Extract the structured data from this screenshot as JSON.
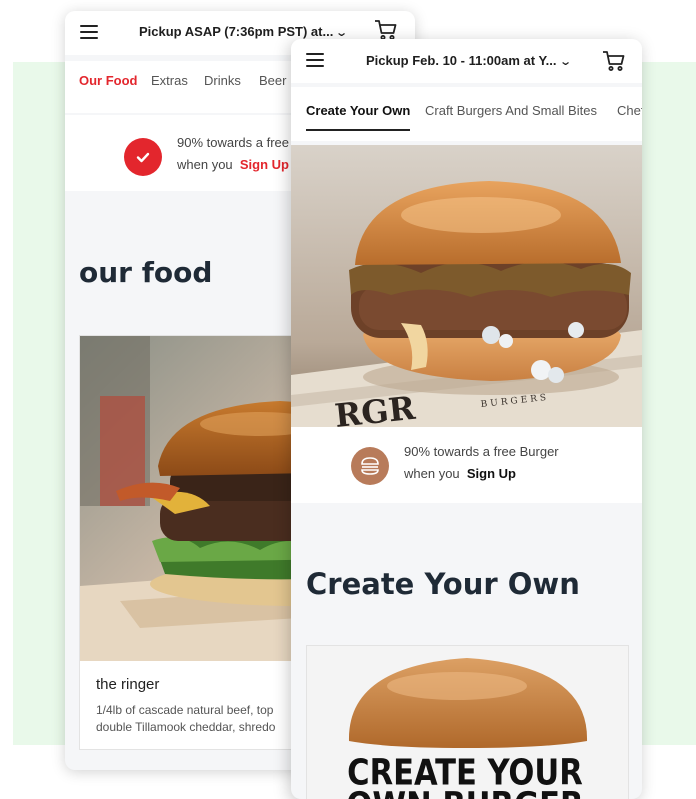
{
  "back_screen": {
    "pickup_label": "Pickup ASAP (7:36pm PST) at...",
    "tabs": [
      {
        "label": "Our Food",
        "active": true
      },
      {
        "label": "Extras",
        "active": false
      },
      {
        "label": "Drinks",
        "active": false
      },
      {
        "label": "Beer",
        "active": false
      }
    ],
    "reward": {
      "line1": "90% towards a free",
      "line2_prefix": "when you",
      "signup": "Sign Up"
    },
    "section_title": "our food",
    "item": {
      "name": "the ringer",
      "desc_line1": "1/4lb of cascade natural beef, top",
      "desc_line2": "double Tillamook cheddar, shredo"
    }
  },
  "front_screen": {
    "pickup_label": "Pickup Feb. 10 - 11:00am at Y...",
    "tabs": [
      {
        "label": "Create Your Own",
        "active": true
      },
      {
        "label": "Craft Burgers And Small Bites",
        "active": false
      },
      {
        "label": "Chef",
        "active": false
      }
    ],
    "reward": {
      "line1": "90% towards a free Burger",
      "line2_prefix": "when you",
      "signup": "Sign Up"
    },
    "section_title": "Create Your Own",
    "hero_paper_text": "RGR",
    "hero_paper_small": "BURGERS",
    "card_title_line1": "CREATE YOUR",
    "card_title_line2": "OWN BURGER"
  },
  "colors": {
    "accent_red": "#e3262d",
    "bg_band": "#e9f9ea",
    "badge_brown": "#b87b5a",
    "title_dark": "#1f2a36"
  },
  "icons": [
    "hamburger-menu-icon",
    "chevron-down-icon",
    "cart-icon",
    "checkmark-icon",
    "burger-icon"
  ]
}
